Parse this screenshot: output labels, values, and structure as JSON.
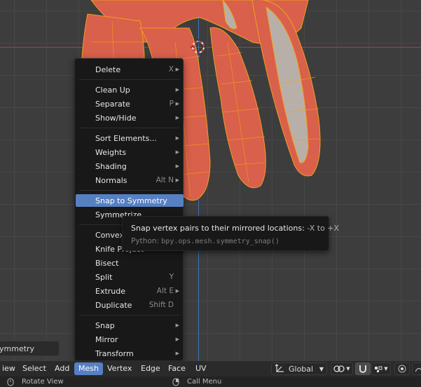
{
  "menu": {
    "items": [
      {
        "label": "Delete",
        "shortcut": "X",
        "submenu": true
      },
      {
        "label": "Clean Up",
        "shortcut": "",
        "submenu": true
      },
      {
        "label": "Separate",
        "shortcut": "P",
        "submenu": true
      },
      {
        "label": "Show/Hide",
        "shortcut": "",
        "submenu": true
      },
      {
        "label": "Sort Elements...",
        "shortcut": "",
        "submenu": true
      },
      {
        "label": "Weights",
        "shortcut": "",
        "submenu": true
      },
      {
        "label": "Shading",
        "shortcut": "",
        "submenu": true
      },
      {
        "label": "Normals",
        "shortcut": "Alt N",
        "submenu": true
      },
      {
        "label": "Snap to Symmetry",
        "shortcut": "",
        "submenu": false
      },
      {
        "label": "Symmetrize",
        "shortcut": "",
        "submenu": false
      },
      {
        "label": "Convex",
        "shortcut": "",
        "submenu": false
      },
      {
        "label": "Knife Project",
        "shortcut": "",
        "submenu": false
      },
      {
        "label": "Bisect",
        "shortcut": "",
        "submenu": false
      },
      {
        "label": "Split",
        "shortcut": "Y",
        "submenu": false
      },
      {
        "label": "Extrude",
        "shortcut": "Alt E",
        "submenu": true
      },
      {
        "label": "Duplicate",
        "shortcut": "Shift D",
        "submenu": false
      },
      {
        "label": "Snap",
        "shortcut": "",
        "submenu": true
      },
      {
        "label": "Mirror",
        "shortcut": "",
        "submenu": true
      },
      {
        "label": "Transform",
        "shortcut": "",
        "submenu": true
      }
    ]
  },
  "tooltip": {
    "description": "Snap vertex pairs to their mirrored locations:",
    "extra": "-X to +X",
    "python_label": "Python:",
    "python_code": "bpy.ops.mesh.symmetry_snap()"
  },
  "last_operator": {
    "label": "ymmetry"
  },
  "header": {
    "view": "iew",
    "select": "Select",
    "add": "Add",
    "mesh": "Mesh",
    "vertex": "Vertex",
    "edge": "Edge",
    "face": "Face",
    "uv": "UV",
    "orientation": "Global"
  },
  "statusbar": {
    "left_action": "Rotate View",
    "right_action": "Call Menu"
  },
  "colors": {
    "accent": "#5680c2",
    "mesh": "#d9604a",
    "axis_x": "#a63b45",
    "axis_y": "#3a73b8"
  }
}
